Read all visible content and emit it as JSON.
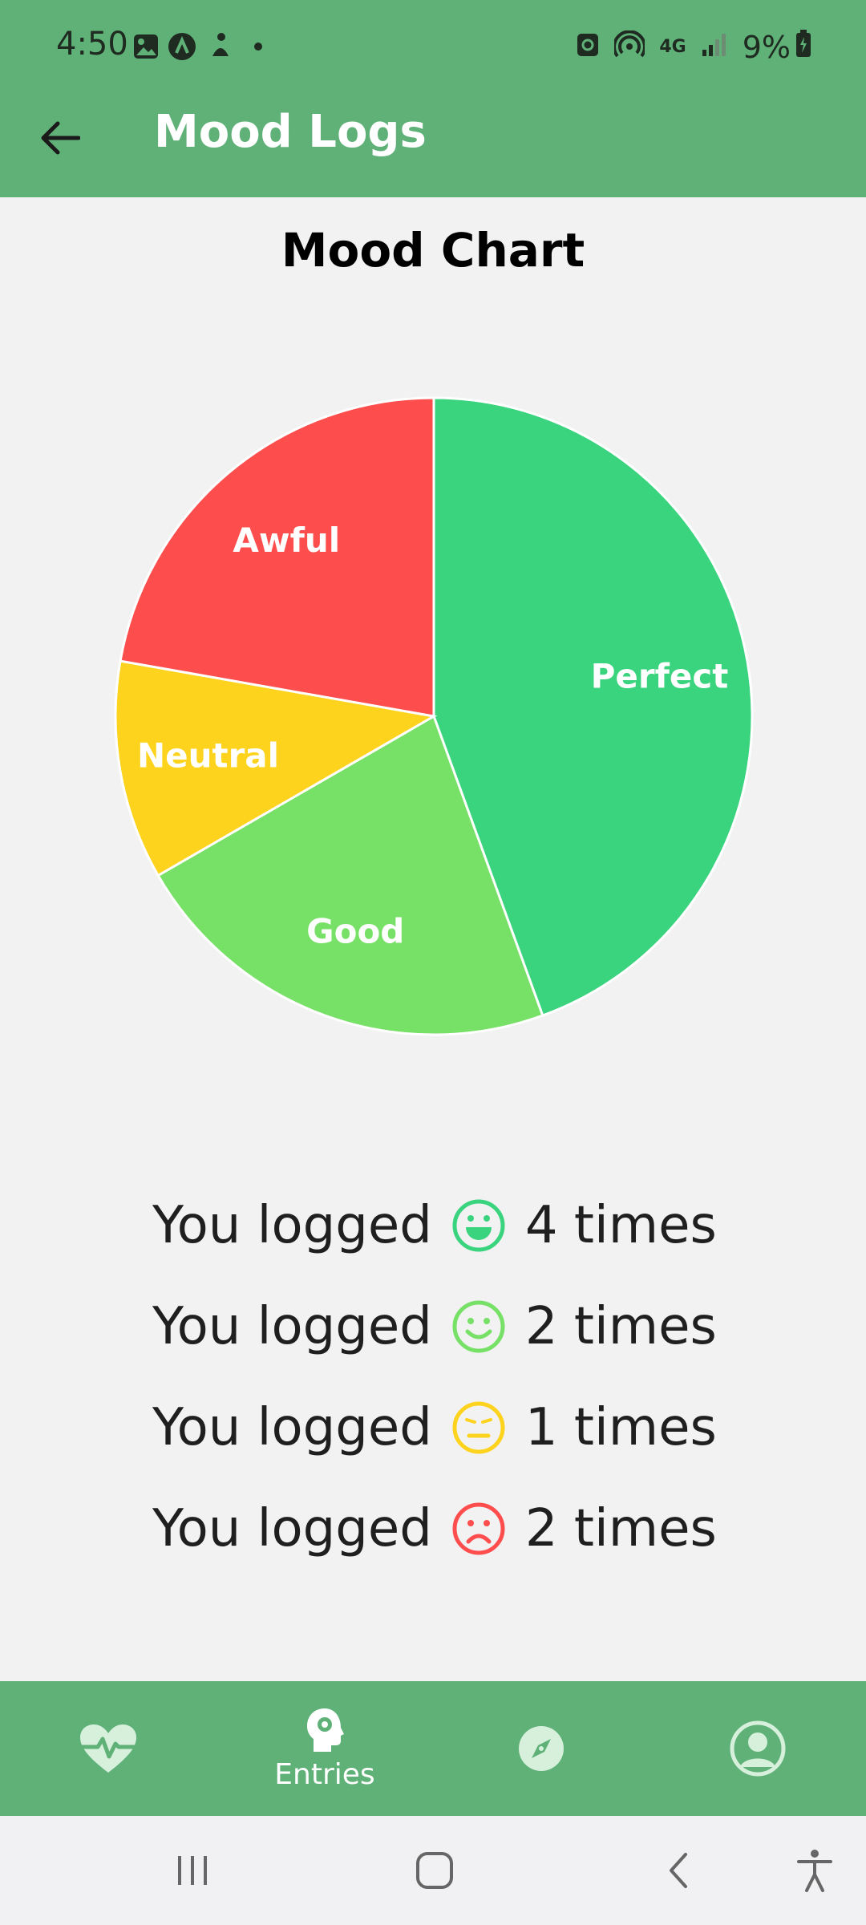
{
  "status_bar": {
    "time": "4:50",
    "network": "4G",
    "battery": "9%"
  },
  "app_bar": {
    "title": "Mood Logs"
  },
  "chart_title": "Mood Chart",
  "chart_data": {
    "type": "pie",
    "title": "Mood Chart",
    "slices": [
      {
        "label": "Perfect",
        "value": 4,
        "color": "#3ad37e"
      },
      {
        "label": "Good",
        "value": 2,
        "color": "#77e066"
      },
      {
        "label": "Neutral",
        "value": 1,
        "color": "#fdd31e"
      },
      {
        "label": "Awful",
        "value": 2,
        "color": "#fe4d4d"
      }
    ]
  },
  "logs": [
    {
      "prefix": "You logged",
      "mood_icon": "laughing-face-icon",
      "count_text": "4 times",
      "color": "#3ad37e"
    },
    {
      "prefix": "You logged",
      "mood_icon": "smiling-face-icon",
      "count_text": "2 times",
      "color": "#77e066"
    },
    {
      "prefix": "You logged",
      "mood_icon": "neutral-face-icon",
      "count_text": "1 times",
      "color": "#fdd31e"
    },
    {
      "prefix": "You logged",
      "mood_icon": "sad-face-icon",
      "count_text": "2 times",
      "color": "#fe4d4d"
    }
  ],
  "bottom_nav": {
    "items": [
      {
        "icon": "heart-pulse-icon",
        "label": ""
      },
      {
        "icon": "head-gear-icon",
        "label": "Entries"
      },
      {
        "icon": "compass-icon",
        "label": ""
      },
      {
        "icon": "profile-icon",
        "label": ""
      }
    ]
  },
  "colors": {
    "primary": "#5fb178",
    "background": "#f2f2f3"
  }
}
